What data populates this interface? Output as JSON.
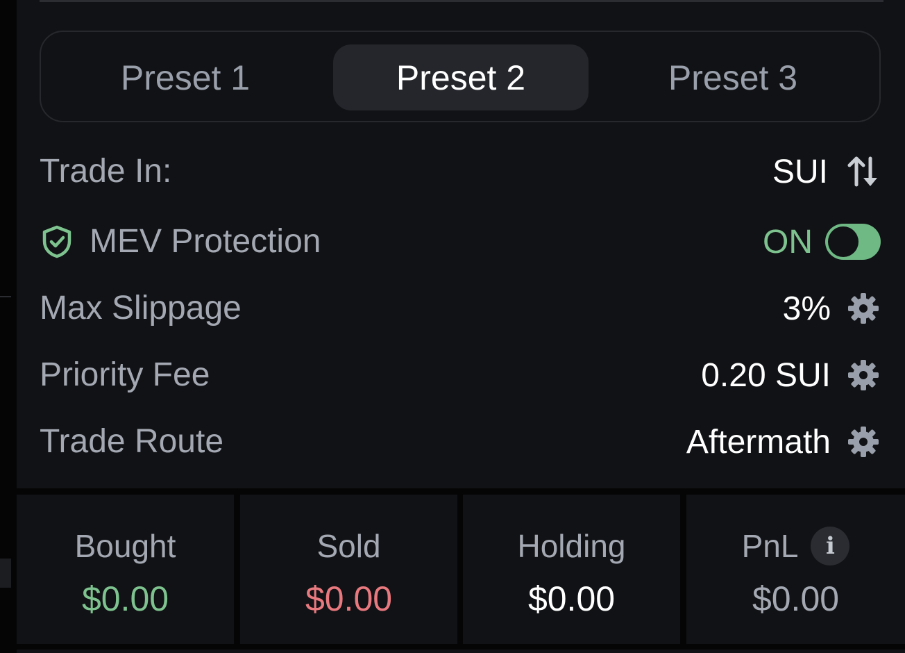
{
  "presets": {
    "tabs": [
      {
        "label": "Preset 1"
      },
      {
        "label": "Preset 2"
      },
      {
        "label": "Preset 3"
      }
    ],
    "active": "Preset 2"
  },
  "settings": {
    "trade_in": {
      "label": "Trade In:",
      "value": "SUI",
      "icon": "swap-arrows-icon"
    },
    "mev": {
      "label": "MEV Protection",
      "status": "ON",
      "enabled": true,
      "icon": "shield-check-icon"
    },
    "max_slippage": {
      "label": "Max Slippage",
      "value": "3%",
      "icon": "gear-icon"
    },
    "priority_fee": {
      "label": "Priority Fee",
      "value": "0.20 SUI",
      "icon": "gear-icon"
    },
    "trade_route": {
      "label": "Trade Route",
      "value": "Aftermath",
      "icon": "gear-icon"
    }
  },
  "stats": {
    "bought": {
      "label": "Bought",
      "value": "$0.00"
    },
    "sold": {
      "label": "Sold",
      "value": "$0.00"
    },
    "holding": {
      "label": "Holding",
      "value": "$0.00"
    },
    "pnl": {
      "label": "PnL",
      "value": "$0.00",
      "info_glyph": "i"
    }
  },
  "colors": {
    "background": "#111215",
    "positive": "#7ec38f",
    "negative": "#e8797f",
    "muted": "#a3a8b2",
    "neutral_value": "#a3a8b2"
  }
}
